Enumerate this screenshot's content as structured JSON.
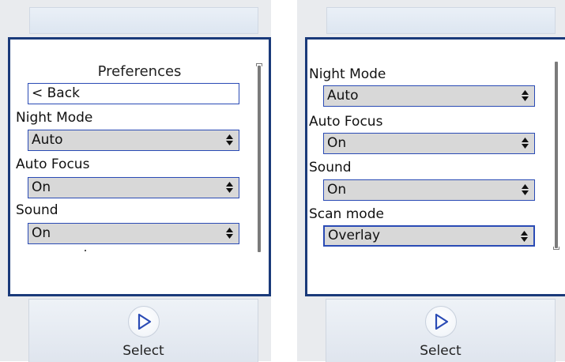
{
  "left_phone": {
    "title": "Preferences",
    "back_label": "< Back",
    "settings": [
      {
        "label": "Night Mode",
        "value": "Auto"
      },
      {
        "label": "Auto Focus",
        "value": "On"
      },
      {
        "label": "Sound",
        "value": "On"
      }
    ],
    "softkey_label": "Select"
  },
  "right_phone": {
    "settings": [
      {
        "label": "Night Mode",
        "value": "Auto"
      },
      {
        "label": "Auto Focus",
        "value": "On"
      },
      {
        "label": "Sound",
        "value": "On"
      },
      {
        "label": "Scan mode",
        "value": "Overlay"
      }
    ],
    "softkey_label": "Select"
  },
  "colors": {
    "frame_border": "#1a3a7a",
    "focus_border": "#2a4bb5",
    "select_fill": "#d8d8d8"
  },
  "icons": {
    "softkey": "play-triangle-icon",
    "dropdown": "up-down-arrows-icon"
  }
}
